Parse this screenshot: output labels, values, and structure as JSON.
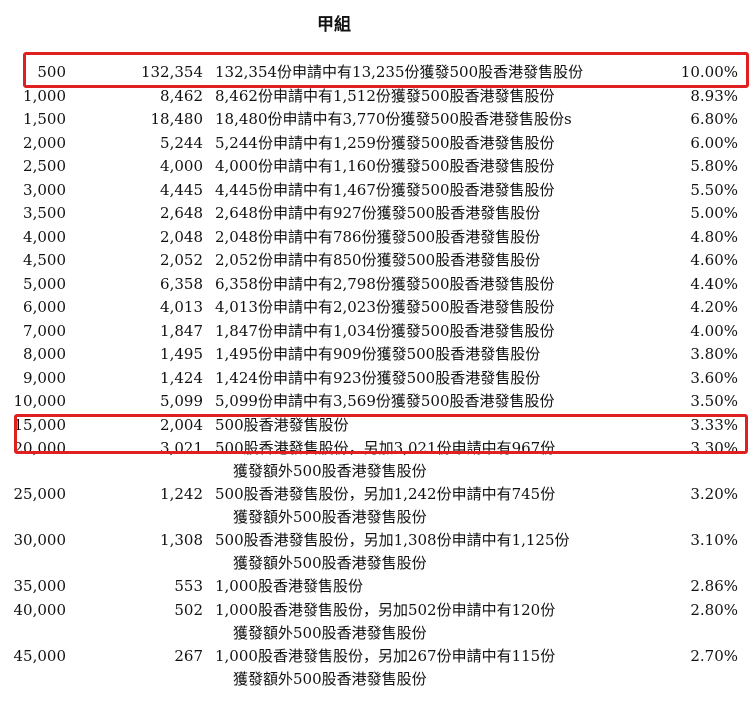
{
  "title": "甲組",
  "rows": [
    {
      "shares": "500",
      "applications": "132,354",
      "basis": "132,354份申請中有13,235份獲發500股香港發售股份",
      "basis2": "",
      "pct": "10.00%"
    },
    {
      "shares": "1,000",
      "applications": "8,462",
      "basis": "8,462份申請中有1,512份獲發500股香港發售股份",
      "basis2": "",
      "pct": "8.93%"
    },
    {
      "shares": "1,500",
      "applications": "18,480",
      "basis": "18,480份申請中有3,770份獲發500股香港發售股份s",
      "basis2": "",
      "pct": "6.80%"
    },
    {
      "shares": "2,000",
      "applications": "5,244",
      "basis": "5,244份申請中有1,259份獲發500股香港發售股份",
      "basis2": "",
      "pct": "6.00%"
    },
    {
      "shares": "2,500",
      "applications": "4,000",
      "basis": "4,000份申請中有1,160份獲發500股香港發售股份",
      "basis2": "",
      "pct": "5.80%"
    },
    {
      "shares": "3,000",
      "applications": "4,445",
      "basis": "4,445份申請中有1,467份獲發500股香港發售股份",
      "basis2": "",
      "pct": "5.50%"
    },
    {
      "shares": "3,500",
      "applications": "2,648",
      "basis": "2,648份申請中有927份獲發500股香港發售股份",
      "basis2": "",
      "pct": "5.00%"
    },
    {
      "shares": "4,000",
      "applications": "2,048",
      "basis": "2,048份申請中有786份獲發500股香港發售股份",
      "basis2": "",
      "pct": "4.80%"
    },
    {
      "shares": "4,500",
      "applications": "2,052",
      "basis": "2,052份申請中有850份獲發500股香港發售股份",
      "basis2": "",
      "pct": "4.60%"
    },
    {
      "shares": "5,000",
      "applications": "6,358",
      "basis": "6,358份申請中有2,798份獲發500股香港發售股份",
      "basis2": "",
      "pct": "4.40%"
    },
    {
      "shares": "6,000",
      "applications": "4,013",
      "basis": "4,013份申請中有2,023份獲發500股香港發售股份",
      "basis2": "",
      "pct": "4.20%"
    },
    {
      "shares": "7,000",
      "applications": "1,847",
      "basis": "1,847份申請中有1,034份獲發500股香港發售股份",
      "basis2": "",
      "pct": "4.00%"
    },
    {
      "shares": "8,000",
      "applications": "1,495",
      "basis": "1,495份申請中有909份獲發500股香港發售股份",
      "basis2": "",
      "pct": "3.80%"
    },
    {
      "shares": "9,000",
      "applications": "1,424",
      "basis": "1,424份申請中有923份獲發500股香港發售股份",
      "basis2": "",
      "pct": "3.60%"
    },
    {
      "shares": "10,000",
      "applications": "5,099",
      "basis": "5,099份申請中有3,569份獲發500股香港發售股份",
      "basis2": "",
      "pct": "3.50%"
    },
    {
      "shares": "15,000",
      "applications": "2,004",
      "basis": "500股香港發售股份",
      "basis2": "",
      "pct": "3.33%"
    },
    {
      "shares": "20,000",
      "applications": "3,021",
      "basis": "500股香港發售股份，另加3,021份申請中有967份",
      "basis2": "獲發額外500股香港發售股份",
      "pct": "3.30%"
    },
    {
      "shares": "25,000",
      "applications": "1,242",
      "basis": "500股香港發售股份，另加1,242份申請中有745份",
      "basis2": "獲發額外500股香港發售股份",
      "pct": "3.20%"
    },
    {
      "shares": "30,000",
      "applications": "1,308",
      "basis": "500股香港發售股份，另加1,308份申請中有1,125份",
      "basis2": "獲發額外500股香港發售股份",
      "pct": "3.10%"
    },
    {
      "shares": "35,000",
      "applications": "553",
      "basis": "1,000股香港發售股份",
      "basis2": "",
      "pct": "2.86%"
    },
    {
      "shares": "40,000",
      "applications": "502",
      "basis": "1,000股香港發售股份，另加502份申請中有120份",
      "basis2": "獲發額外500股香港發售股份",
      "pct": "2.80%"
    },
    {
      "shares": "45,000",
      "applications": "267",
      "basis": "1,000股香港發售股份，另加267份申請中有115份",
      "basis2": "獲發額外500股香港發售股份",
      "pct": "2.70%"
    }
  ],
  "highlight_color": "#e02020"
}
